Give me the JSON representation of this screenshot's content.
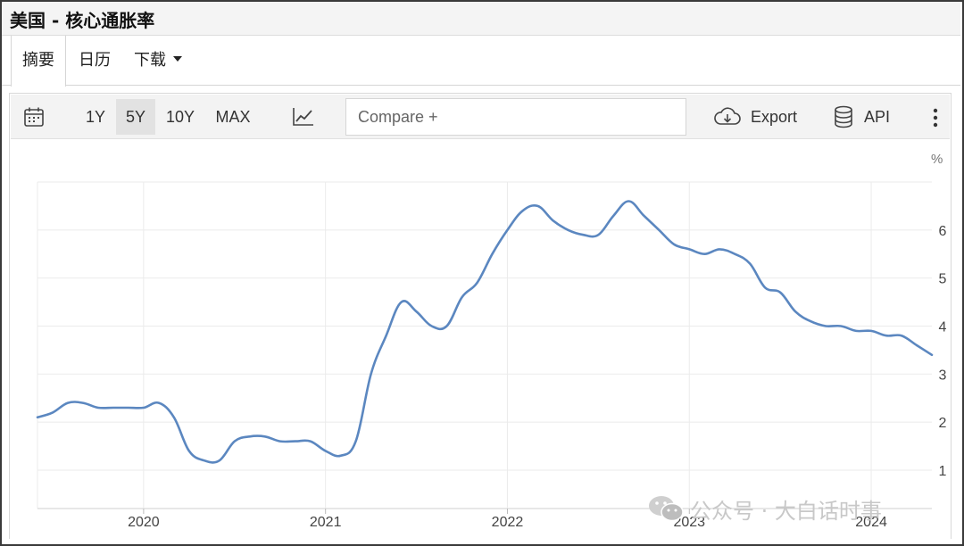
{
  "window": {
    "title": "美国 - 核心通胀率"
  },
  "tabs": [
    {
      "label": "摘要",
      "active": true
    },
    {
      "label": "日历",
      "active": false
    },
    {
      "label": "下载",
      "active": false,
      "has_dropdown": true
    }
  ],
  "toolbar": {
    "calendar_icon": "calendar-icon",
    "ranges": [
      {
        "label": "1Y",
        "active": false
      },
      {
        "label": "5Y",
        "active": true
      },
      {
        "label": "10Y",
        "active": false
      },
      {
        "label": "MAX",
        "active": false
      }
    ],
    "chart_type_icon": "line-chart-icon",
    "compare_placeholder": "Compare +",
    "export_label": "Export",
    "export_icon": "cloud-download-icon",
    "api_label": "API",
    "api_icon": "database-icon",
    "more_icon": "vertical-ellipsis-icon"
  },
  "watermark": {
    "text": "公众号 · 大白话时事",
    "icon": "wechat-icon"
  },
  "colors": {
    "line": "#5b87c0",
    "grid": "#ebebeb",
    "toolbar_bg": "#f3f3f3",
    "active_range_bg": "#e2e2e2"
  },
  "chart_data": {
    "type": "line",
    "title": "",
    "xlabel": "",
    "ylabel": "%",
    "unit": "%",
    "x_ticks": [
      "2020",
      "2021",
      "2022",
      "2023",
      "2024"
    ],
    "y_ticks": [
      1,
      2,
      3,
      4,
      5,
      6
    ],
    "xlim": [
      "2019-06",
      "2024-05"
    ],
    "ylim": [
      0.2,
      7.0
    ],
    "grid": true,
    "y_axis_position": "right",
    "series": [
      {
        "x": [
          "2019-06",
          "2019-07",
          "2019-08",
          "2019-09",
          "2019-10",
          "2019-11",
          "2019-12",
          "2020-01",
          "2020-02",
          "2020-03",
          "2020-04",
          "2020-05",
          "2020-06",
          "2020-07",
          "2020-08",
          "2020-09",
          "2020-10",
          "2020-11",
          "2020-12",
          "2021-01",
          "2021-02",
          "2021-03",
          "2021-04",
          "2021-05",
          "2021-06",
          "2021-07",
          "2021-08",
          "2021-09",
          "2021-10",
          "2021-11",
          "2021-12",
          "2022-01",
          "2022-02",
          "2022-03",
          "2022-04",
          "2022-05",
          "2022-06",
          "2022-07",
          "2022-08",
          "2022-09",
          "2022-10",
          "2022-11",
          "2022-12",
          "2023-01",
          "2023-02",
          "2023-03",
          "2023-04",
          "2023-05",
          "2023-06",
          "2023-07",
          "2023-08",
          "2023-09",
          "2023-10",
          "2023-11",
          "2023-12",
          "2024-01",
          "2024-02",
          "2024-03",
          "2024-04",
          "2024-05"
        ],
        "values": [
          2.1,
          2.2,
          2.4,
          2.4,
          2.3,
          2.3,
          2.3,
          2.3,
          2.4,
          2.1,
          1.4,
          1.2,
          1.2,
          1.6,
          1.7,
          1.7,
          1.6,
          1.6,
          1.6,
          1.4,
          1.3,
          1.6,
          3.0,
          3.8,
          4.5,
          4.3,
          4.0,
          4.0,
          4.6,
          4.9,
          5.5,
          6.0,
          6.4,
          6.5,
          6.2,
          6.0,
          5.9,
          5.9,
          6.3,
          6.6,
          6.3,
          6.0,
          5.7,
          5.6,
          5.5,
          5.6,
          5.5,
          5.3,
          4.8,
          4.7,
          4.3,
          4.1,
          4.0,
          4.0,
          3.9,
          3.9,
          3.8,
          3.8,
          3.6,
          3.4
        ]
      }
    ]
  }
}
